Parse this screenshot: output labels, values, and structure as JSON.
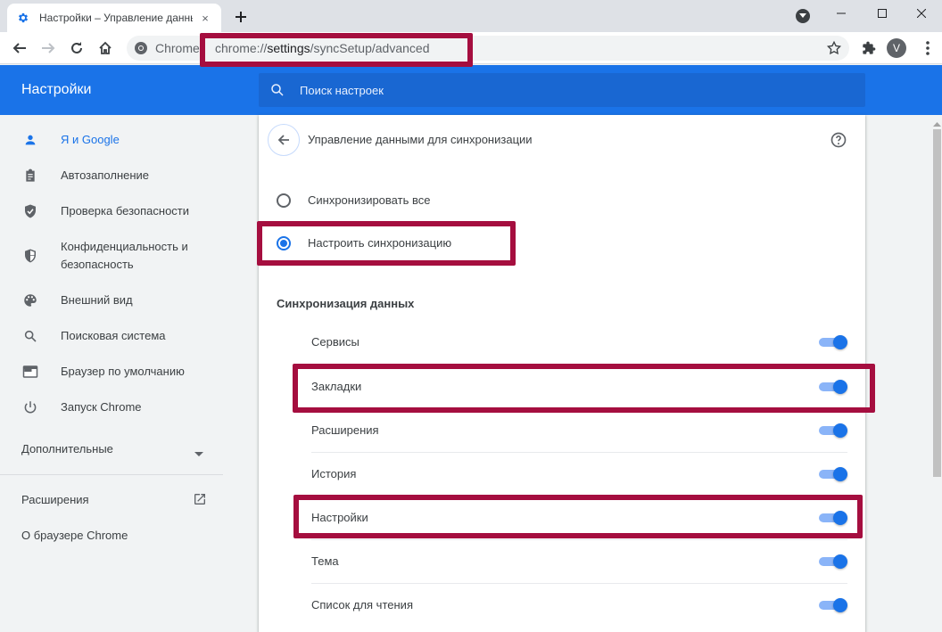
{
  "browser": {
    "tab_title": "Настройки – Управление данными для синхронизации",
    "tab_close": "×",
    "omnibox_chip": "Chrome",
    "url_prefix": "chrome://",
    "url_host": "settings",
    "url_path": "/syncSetup/advanced",
    "avatar_letter": "V"
  },
  "header": {
    "app_title": "Настройки",
    "search_placeholder": "Поиск настроек"
  },
  "sidebar": {
    "items": [
      {
        "label": "Я и Google",
        "icon": "person-icon",
        "active": true
      },
      {
        "label": "Автозаполнение",
        "icon": "clipboard-icon"
      },
      {
        "label": "Проверка безопасности",
        "icon": "shield-check-icon"
      },
      {
        "label": "Конфиденциальность и безопасность",
        "icon": "shield-icon"
      },
      {
        "label": "Внешний вид",
        "icon": "palette-icon"
      },
      {
        "label": "Поисковая система",
        "icon": "search-icon"
      },
      {
        "label": "Браузер по умолчанию",
        "icon": "browser-icon"
      },
      {
        "label": "Запуск Chrome",
        "icon": "power-icon"
      }
    ],
    "advanced_label": "Дополнительные",
    "extensions_label": "Расширения",
    "about_label": "О браузере Chrome"
  },
  "main": {
    "subpage_title": "Управление данными для синхронизации",
    "radio_sync_all": "Синхронизировать все",
    "radio_custom": "Настроить синхронизацию",
    "selected_radio": "custom",
    "section_title": "Синхронизация данных",
    "sync_items": [
      {
        "label": "Сервисы",
        "enabled": true
      },
      {
        "label": "Закладки",
        "enabled": true
      },
      {
        "label": "Расширения",
        "enabled": true
      },
      {
        "label": "История",
        "enabled": true
      },
      {
        "label": "Настройки",
        "enabled": true
      },
      {
        "label": "Тема",
        "enabled": true
      },
      {
        "label": "Список для чтения",
        "enabled": true
      }
    ]
  },
  "colors": {
    "accent": "#1a73e8",
    "highlight": "#a50e3f"
  }
}
